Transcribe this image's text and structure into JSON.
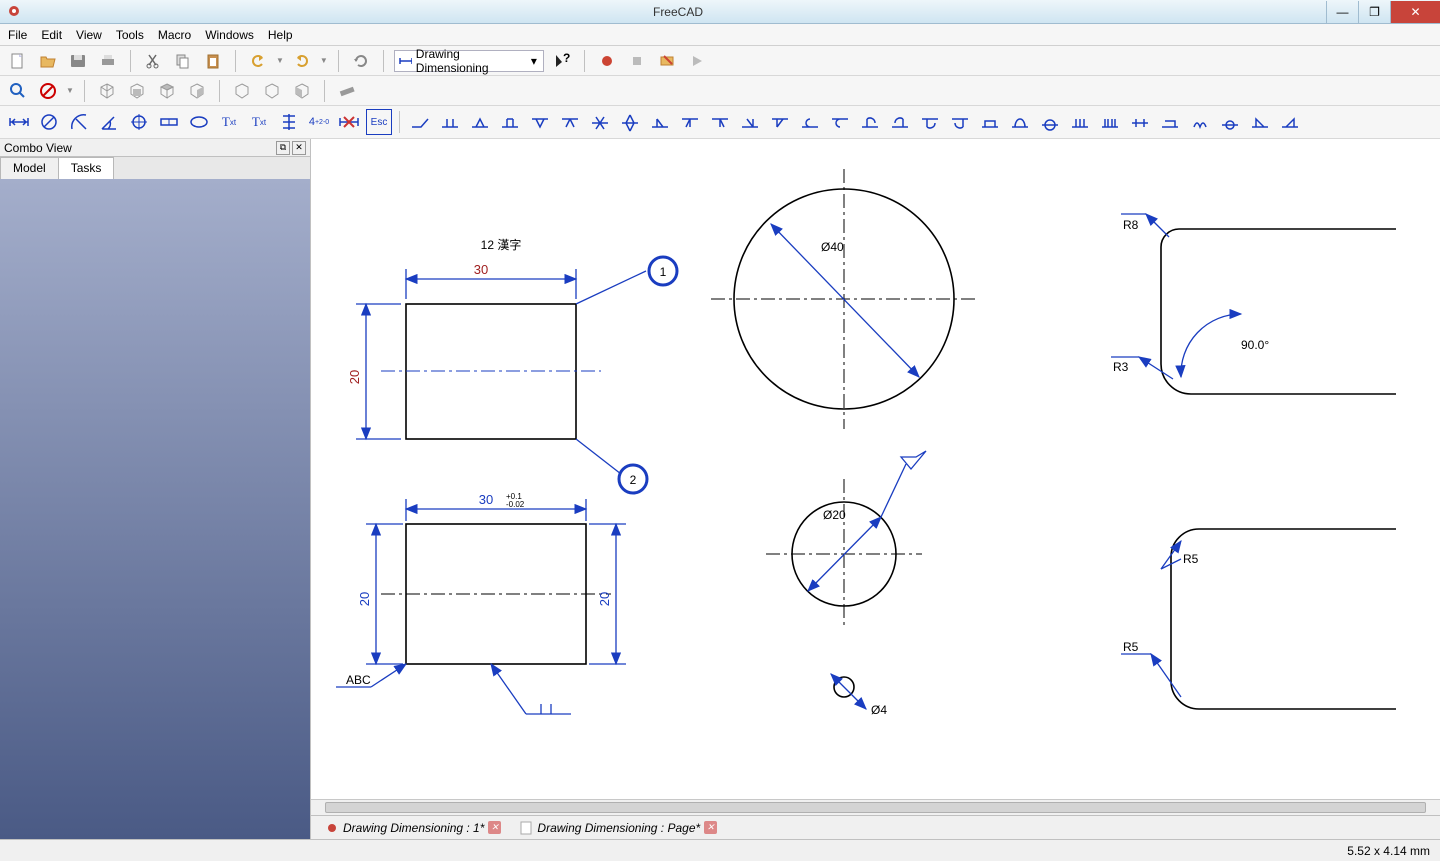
{
  "window": {
    "title": "FreeCAD"
  },
  "menu": {
    "file": "File",
    "edit": "Edit",
    "view": "View",
    "tools": "Tools",
    "macro": "Macro",
    "windows": "Windows",
    "help": "Help"
  },
  "workbench": {
    "selected": "Drawing Dimensioning"
  },
  "combo": {
    "title": "Combo View",
    "tabs": {
      "model": "Model",
      "tasks": "Tasks"
    }
  },
  "drawing": {
    "labels": {
      "top_note": "12 漢字",
      "dim30": "30",
      "dim20v": "20",
      "dim30tol": "30",
      "tolplus": "+0.1",
      "tolminus": "-0.02",
      "dim20a": "20",
      "dim20b": "20",
      "abc": "ABC",
      "dia40": "Ø40",
      "dia20": "Ø20",
      "dia4": "Ø4",
      "r8": "R8",
      "r3": "R3",
      "r5a": "R5",
      "r5b": "R5",
      "ang90": "90.0°",
      "bubble1": "1",
      "bubble2": "2"
    }
  },
  "doc_tabs": {
    "tab1": "Drawing Dimensioning : 1*",
    "tab2": "Drawing Dimensioning : Page*"
  },
  "status": {
    "coords": "5.52 x 4.14 mm"
  }
}
